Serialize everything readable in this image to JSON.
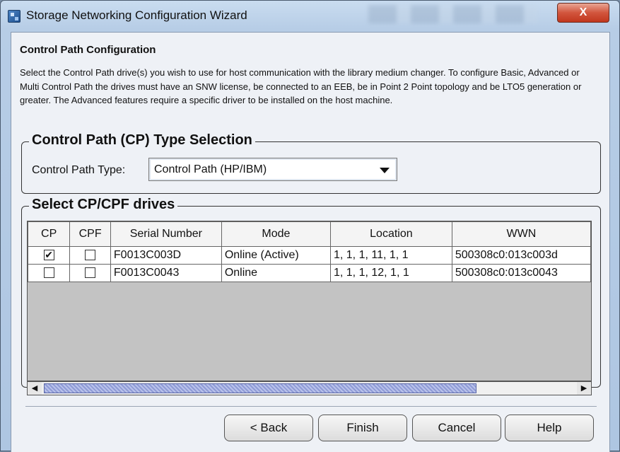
{
  "window": {
    "title": "Storage Networking Configuration Wizard",
    "close_symbol": "X"
  },
  "section": {
    "title": "Control Path Configuration",
    "description": "Select the Control Path drive(s) you wish to use for host communication with the library medium changer. To configure Basic, Advanced or Multi Control Path the drives must have an SNW license, be connected to an EEB, be in Point 2 Point topology and be LTO5 generation or greater. The Advanced features require a specific driver to be installed on the host machine."
  },
  "cp_type": {
    "legend": "Control Path (CP) Type Selection",
    "label": "Control Path Type:",
    "selected": "Control Path (HP/IBM)"
  },
  "drives": {
    "legend": "Select CP/CPF drives",
    "columns": [
      "CP",
      "CPF",
      "Serial Number",
      "Mode",
      "Location",
      "WWN"
    ],
    "rows": [
      {
        "cp": true,
        "cpf": false,
        "serial": "F0013C003D",
        "mode": "Online (Active)",
        "location": "1, 1, 1, 11, 1, 1",
        "wwn": "500308c0:013c003d"
      },
      {
        "cp": false,
        "cpf": false,
        "serial": "F0013C0043",
        "mode": "Online",
        "location": "1, 1, 1, 12, 1, 1",
        "wwn": "500308c0:013c0043"
      }
    ],
    "scroll_left": "◀",
    "scroll_right": "▶"
  },
  "buttons": {
    "back": "< Back",
    "finish": "Finish",
    "cancel": "Cancel",
    "help": "Help"
  },
  "colors": {
    "title_bar": "#b7cde6",
    "close_button": "#c1371e",
    "panel": "#eef1f6",
    "table_empty": "#c3c3c3",
    "scroll_thumb": "#8f9bd6"
  },
  "icons": {
    "app": "wizard-app-icon",
    "close": "close-icon",
    "dropdown": "chevron-down-icon",
    "check": "check-icon"
  }
}
